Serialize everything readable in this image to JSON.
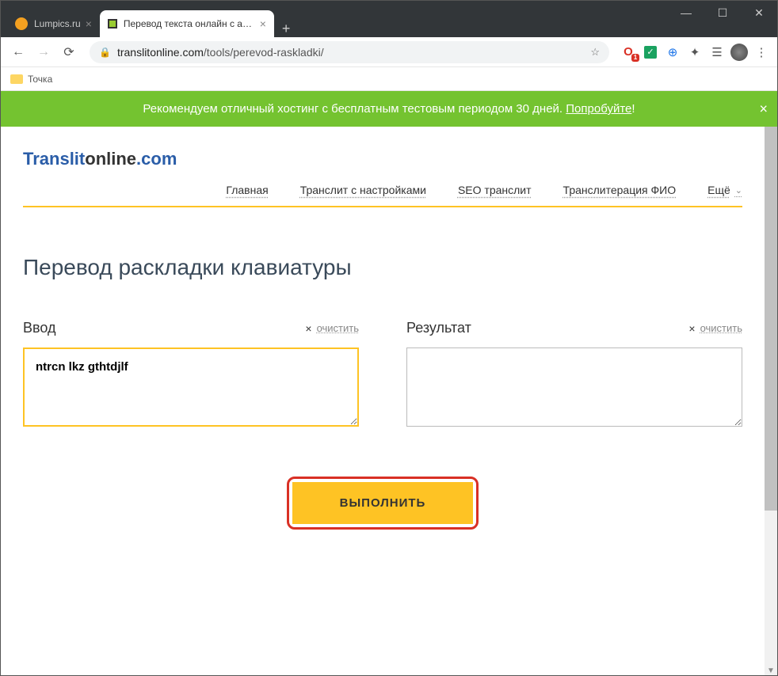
{
  "browser": {
    "tabs": [
      {
        "title": "Lumpics.ru",
        "active": false,
        "favicon_color": "#f4a020"
      },
      {
        "title": "Перевод текста онлайн с англи",
        "active": true,
        "favicon_color": "#9acd32"
      }
    ],
    "url_domain": "translitonline.com",
    "url_path": "/tools/perevod-raskladki/",
    "bookmark": "Точка"
  },
  "banner": {
    "text": "Рекомендуем отличный хостинг с бесплатным тестовым периодом 30 дней. ",
    "link_text": "Попробуйте",
    "exclaim": "!"
  },
  "logo": {
    "part1": "Translit",
    "part2": "online",
    "part3": ".com"
  },
  "nav": {
    "items": [
      "Главная",
      "Транслит с настройками",
      "SEO транслит",
      "Транслитерация ФИО"
    ],
    "more": "Ещё"
  },
  "page_title": "Перевод раскладки клавиатуры",
  "input": {
    "label": "Ввод",
    "clear": "очистить",
    "value": "ntrcn lkz gthtdjlf"
  },
  "output": {
    "label": "Результат",
    "clear": "очистить",
    "value": ""
  },
  "submit": {
    "label": "ВЫПОЛНИТЬ"
  }
}
